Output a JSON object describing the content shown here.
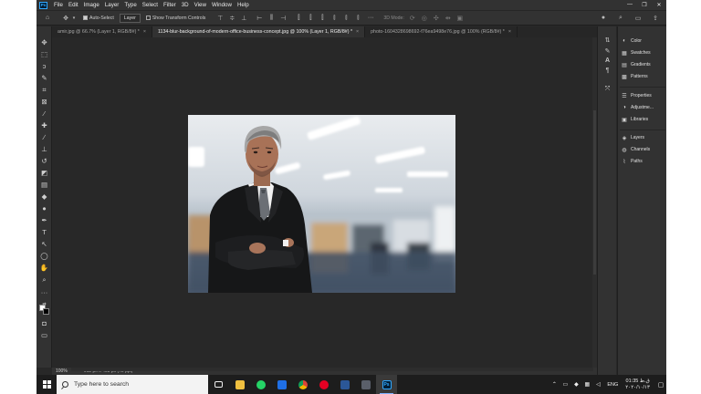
{
  "app": {
    "logo_text": "Ps",
    "menu": [
      "File",
      "Edit",
      "Image",
      "Layer",
      "Type",
      "Select",
      "Filter",
      "3D",
      "View",
      "Window",
      "Help"
    ],
    "window_controls": [
      "—",
      "❐",
      "✕"
    ]
  },
  "options_bar": {
    "auto_select_label": "Auto-Select",
    "auto_select_target": "Layer",
    "transform_label": "Show Transform Controls",
    "mode_3d_label": "3D Mode:"
  },
  "tabs": [
    {
      "label": "amir.jpg @ 66.7% (Layer 1, RGB/8#) *",
      "close": "×"
    },
    {
      "label": "1134-blur-background-of-modern-office-business-concept.jpg @ 100% (Layer 1, RGB/8#) *",
      "close": "×"
    },
    {
      "label": "photo-1604328698692-f76ea9498e76.jpg @ 100% (RGB/8#) *",
      "close": "×"
    }
  ],
  "status_bar": {
    "zoom": "100%",
    "doc_info": "612 px x 408 px (72 ppi)"
  },
  "panels": {
    "group1": [
      "Color",
      "Swatches",
      "Gradients",
      "Patterns"
    ],
    "group2": [
      "Properties",
      "Adjustme...",
      "Libraries"
    ],
    "group3": [
      "Layers",
      "Channels",
      "Paths"
    ]
  },
  "taskbar": {
    "search_placeholder": "Type here to search",
    "language": "ENG",
    "time": "01:35 ق.ظ",
    "date": "۲۰۲۰/۱۰/۱۳"
  },
  "colors": {
    "accent": "#31a8ff",
    "workspace": "#282828",
    "panel": "#323232"
  }
}
